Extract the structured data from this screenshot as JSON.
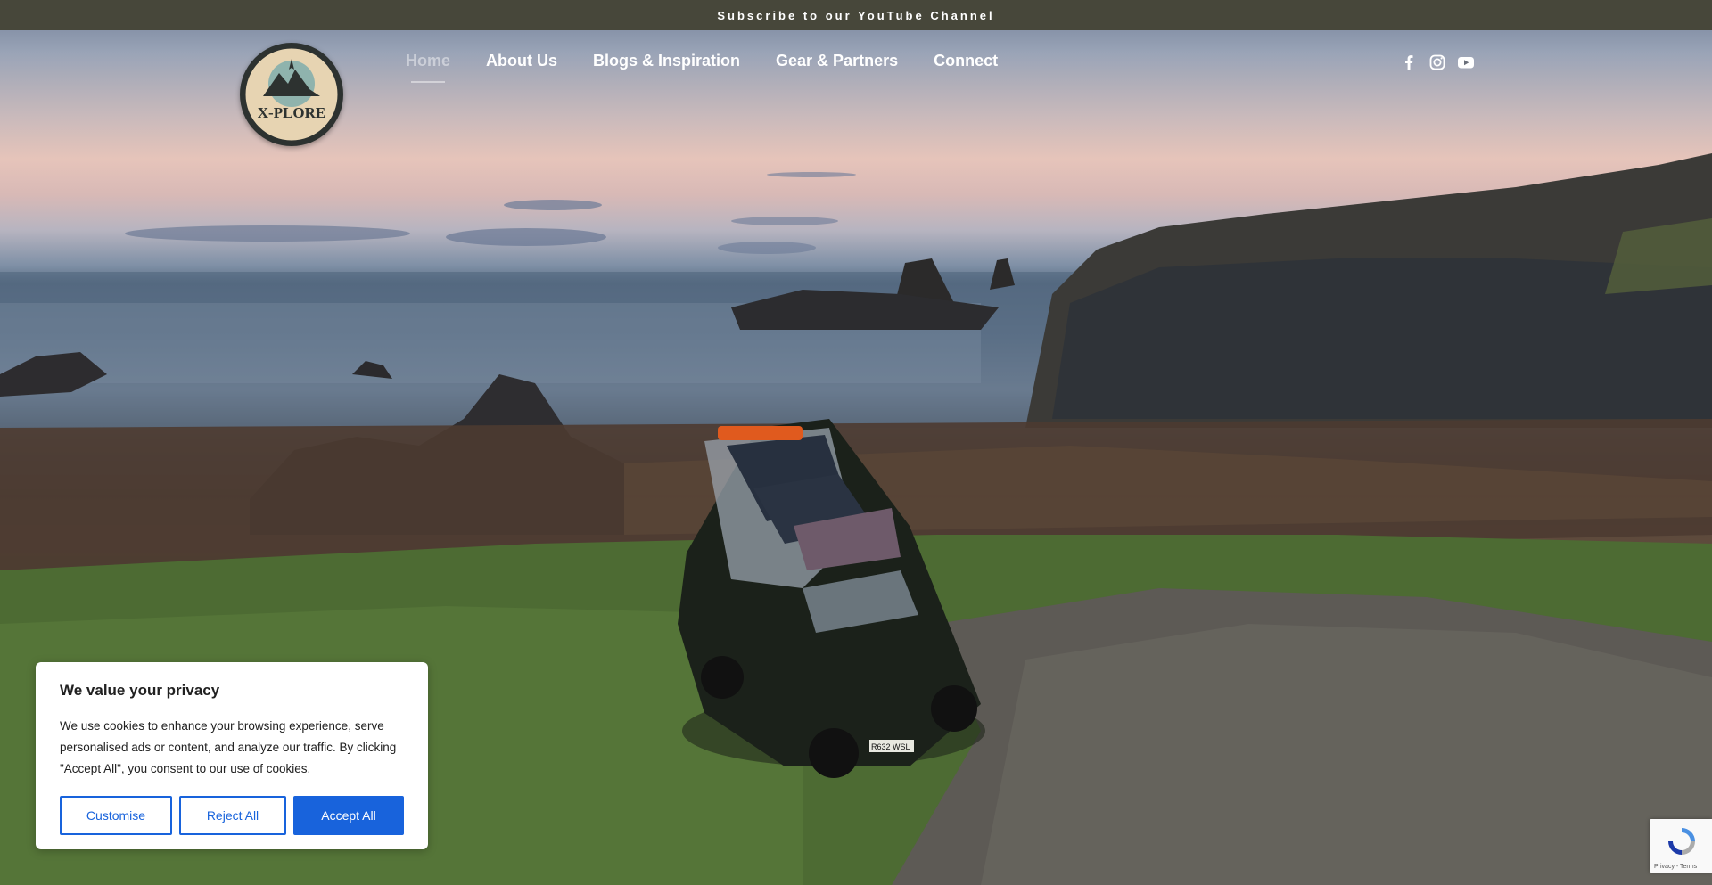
{
  "announcement": {
    "text": "Subscribe to our YouTube Channel"
  },
  "logo": {
    "text": "X-PLORE"
  },
  "nav": {
    "items": [
      {
        "label": "Home",
        "active": true
      },
      {
        "label": "About Us",
        "active": false
      },
      {
        "label": "Blogs & Inspiration",
        "active": false
      },
      {
        "label": "Gear & Partners",
        "active": false
      },
      {
        "label": "Connect",
        "active": false
      }
    ]
  },
  "social": {
    "icons": [
      "facebook-icon",
      "instagram-icon",
      "youtube-icon"
    ]
  },
  "hero": {
    "vehicle_plate": "R632 WSL"
  },
  "cookie_banner": {
    "title": "We value your privacy",
    "body": "We use cookies to enhance your browsing experience, serve personalised ads or content, and analyze our traffic. By clicking \"Accept All\", you consent to our use of cookies.",
    "customise_label": "Customise",
    "reject_label": "Reject All",
    "accept_label": "Accept All",
    "accent_color": "#1863dc"
  },
  "recaptcha": {
    "terms": "Privacy - Terms"
  },
  "colors": {
    "topbar_bg": "#47473a",
    "nav_text": "#ffffff"
  }
}
